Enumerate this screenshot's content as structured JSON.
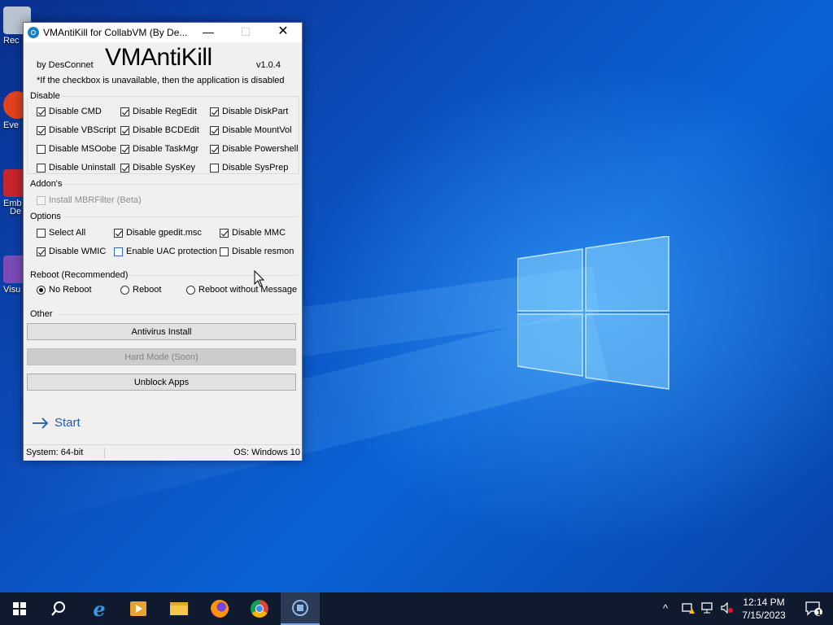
{
  "desktop": {
    "icons": [
      {
        "label": "Rec",
        "color": "#b9c4d2"
      },
      {
        "label": "Eve",
        "color": "#e0431d"
      },
      {
        "label": "Emb",
        "label2": "De",
        "color": "#c7252c"
      },
      {
        "label": "Visu",
        "color": "#7b4bb6"
      }
    ]
  },
  "window": {
    "title": "VMAntiKill for CollabVM (By De...",
    "controls": {
      "minimize": "—",
      "maximize": "☐",
      "close": "✕"
    },
    "by_line": "by DesConnet",
    "app_name": "VMAntiKill",
    "version": "v1.0.4",
    "note": "*If the checkbox is unavailable, then the application is disabled",
    "disable_group": {
      "label": "Disable",
      "items": [
        {
          "label": "Disable CMD",
          "checked": true
        },
        {
          "label": "Disable RegEdit",
          "checked": true
        },
        {
          "label": "Disable DiskPart",
          "checked": true
        },
        {
          "label": "Disable VBScript",
          "checked": true
        },
        {
          "label": "Disable BCDEdit",
          "checked": true
        },
        {
          "label": "Disable MountVol",
          "checked": true
        },
        {
          "label": "Disable MSOobe",
          "checked": false
        },
        {
          "label": "Disable TaskMgr",
          "checked": true
        },
        {
          "label": "Disable Powershell",
          "checked": true
        },
        {
          "label": "Disable Uninstall",
          "checked": false
        },
        {
          "label": "Disable SysKey",
          "checked": true
        },
        {
          "label": "Disable SysPrep",
          "checked": false
        }
      ]
    },
    "addons_group": {
      "label": "Addon's",
      "items": [
        {
          "label": "Install MBRFilter (Beta)",
          "checked": false,
          "enabled": false
        }
      ]
    },
    "options_group": {
      "label": "Options",
      "items": [
        {
          "label": "Select All",
          "checked": false
        },
        {
          "label": "Disable gpedit.msc",
          "checked": true
        },
        {
          "label": "Disable MMC",
          "checked": true
        },
        {
          "label": "Disable WMIC",
          "checked": true
        },
        {
          "label": "Enable UAC protection",
          "checked": false
        },
        {
          "label": "Disable resmon",
          "checked": false
        }
      ]
    },
    "reboot_group": {
      "label": "Reboot (Recommended)",
      "options": [
        {
          "label": "No Reboot",
          "selected": true
        },
        {
          "label": "Reboot",
          "selected": false
        },
        {
          "label": "Reboot without Message",
          "selected": false
        }
      ]
    },
    "other_group": {
      "label": "Other",
      "buttons": [
        {
          "label": "Antivirus Install",
          "enabled": true
        },
        {
          "label": "Hard Mode (Soon)",
          "enabled": false
        },
        {
          "label": "Unblock Apps",
          "enabled": true
        }
      ]
    },
    "start_label": "Start",
    "status": {
      "system": "System: 64-bit",
      "os": "OS: Windows 10"
    }
  },
  "taskbar": {
    "apps": [
      "start-button",
      "search",
      "internet-explorer",
      "media-player",
      "file-explorer",
      "firefox",
      "chrome",
      "vmantikill"
    ],
    "tray_icons": [
      "chevron-up-icon",
      "network-warning-icon",
      "display-icon",
      "volume-muted-icon"
    ],
    "time": "12:14 PM",
    "date": "7/15/2023",
    "notifications": "1"
  }
}
